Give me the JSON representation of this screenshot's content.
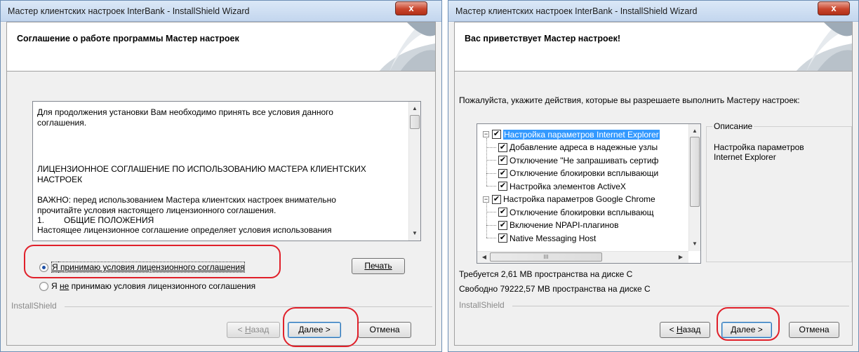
{
  "window1": {
    "title": "Мастер клиентских настроек InterBank - InstallShield Wizard",
    "close_label": "x",
    "header_title": "Соглашение о работе программы Мастер настроек",
    "license_text": [
      "Для продолжения установки Вам необходимо принять все условия данного",
      "соглашения.",
      "ЛИЦЕНЗИОННОЕ СОГЛАШЕНИЕ ПО ИСПОЛЬЗОВАНИЮ МАСТЕРА КЛИЕНТСКИХ",
      "НАСТРОЕК",
      "ВАЖНО: перед использованием Мастера клиентских настроек внимательно",
      "прочитайте условия настоящего лицензионного соглашения.",
      "1.",
      "ОБЩИЕ ПОЛОЖЕНИЯ",
      "Настоящее лицензионное соглашение определяет условия использования"
    ],
    "accept_pre": "Я",
    "accept_u": " принимаю условия лицензионного соглашения",
    "decline_pre": "Я ",
    "decline_u": "не",
    "decline_post": " принимаю условия лицензионного соглашения",
    "print_label": "Печать",
    "installshield": "InstallShield",
    "back_lt": "< ",
    "back_u": "Н",
    "back_rest": "азад",
    "next_u": "Д",
    "next_rest": "алее >",
    "cancel_label": "Отмена"
  },
  "window2": {
    "title": "Мастер клиентских настроек InterBank - InstallShield Wizard",
    "close_label": "x",
    "header_title": "Вас приветствует Мастер настроек!",
    "prompt": "Пожалуйста, укажите действия, которые вы разрешаете выполнить Мастеру настроек:",
    "tree": [
      {
        "label": "Настройка параметров Internet Explorer",
        "level": 0,
        "checked": "✔",
        "expander": "−",
        "selected": true
      },
      {
        "label": "Добавление адреса в надежные узлы",
        "level": 1,
        "checked": "✔"
      },
      {
        "label": "Отключение \"Не запрашивать сертиф",
        "level": 1,
        "checked": "✔"
      },
      {
        "label": "Отключение блокировки всплывающи",
        "level": 1,
        "checked": "✔"
      },
      {
        "label": "Настройка элементов ActiveX",
        "level": 1,
        "checked": "✔"
      },
      {
        "label": "Настройка параметров Google Chrome",
        "level": 0,
        "checked": "✔",
        "expander": "−"
      },
      {
        "label": "Отключение блокировки всплывающ",
        "level": 1,
        "checked": "✔"
      },
      {
        "label": "Включение NPAPI-плагинов",
        "level": 1,
        "checked": "✔"
      },
      {
        "label": "Native Messaging Host",
        "level": 1,
        "checked": "✔"
      }
    ],
    "description_title": "Описание",
    "description_text": [
      "Настройка параметров",
      "Internet Explorer"
    ],
    "disk_required": "Требуется 2,61 МВ пространства на диске С",
    "disk_free": "Свободно 79222,57 МВ пространства на диске С",
    "hscroll_grip": "III",
    "installshield": "InstallShield",
    "back_lt": "< ",
    "back_u": "Н",
    "back_rest": "азад",
    "next_u": "Д",
    "next_rest": "алее >",
    "cancel_label": "Отмена"
  },
  "colors": {
    "annotation": "#e0202a",
    "selection": "#3399ff"
  }
}
